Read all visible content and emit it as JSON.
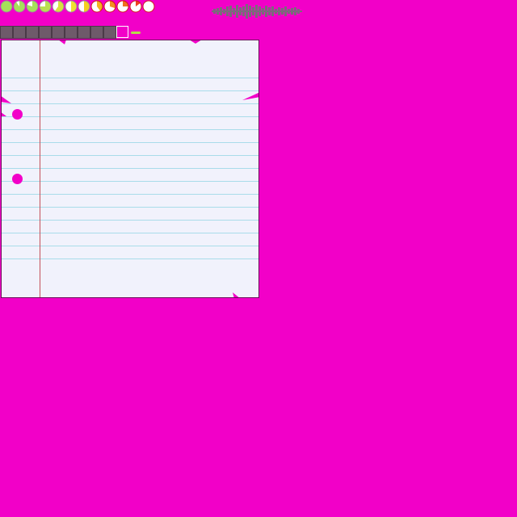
{
  "colors": {
    "background": "#f200c8",
    "paper": "#f1f2fc",
    "ruled_line": "#a9dcea",
    "margin_line": "#c4505a",
    "slot": "#6e5a6a",
    "slot_selected": "#f200c8",
    "indicator": "#b7d94a"
  },
  "progress_pies": [
    {
      "fill": 1.0,
      "color": "#a6e05a"
    },
    {
      "fill": 0.9,
      "color": "#a6e05a"
    },
    {
      "fill": 0.8,
      "color": "#a6e05a"
    },
    {
      "fill": 0.75,
      "color": "#b9e050"
    },
    {
      "fill": 0.6,
      "color": "#d8e040"
    },
    {
      "fill": 0.5,
      "color": "#f0e030"
    },
    {
      "fill": 0.5,
      "color": "#f4d020"
    },
    {
      "fill": 0.4,
      "color": "#f4b020"
    },
    {
      "fill": 0.3,
      "color": "#f29020"
    },
    {
      "fill": 0.25,
      "color": "#f07020"
    },
    {
      "fill": 0.15,
      "color": "#ee4020"
    },
    {
      "fill": 0.0,
      "color": "#ee3020"
    }
  ],
  "waveform_icon": "audio-waveform-icon",
  "inventory": {
    "slot_count": 10,
    "selected_index": 9
  },
  "notebook": {
    "ruled_line_count": 15,
    "hole_count": 2
  }
}
